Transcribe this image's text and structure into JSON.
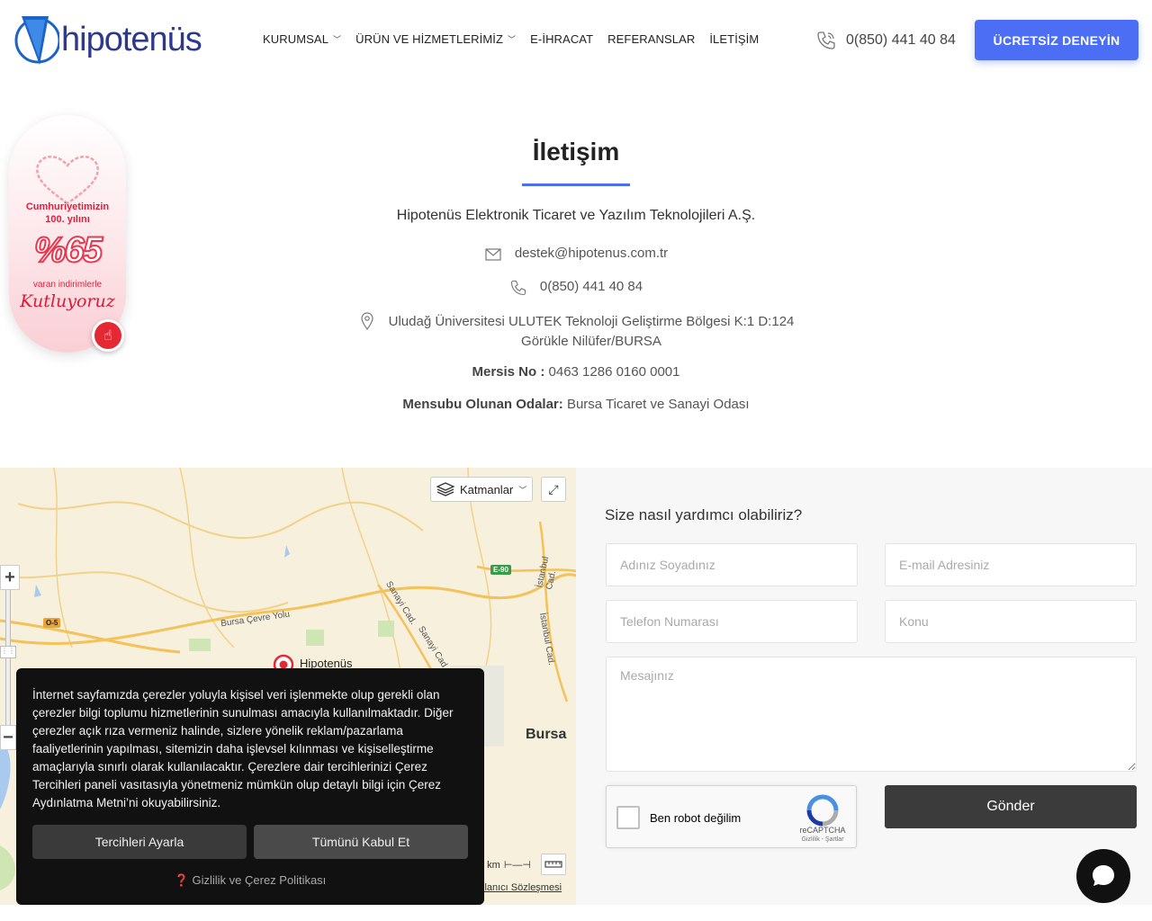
{
  "header": {
    "logo_text": "hipotenüs",
    "nav": [
      {
        "label": "KURUMSAL",
        "has_dropdown": true
      },
      {
        "label": "ÜRÜN VE HİZMETLERİMİZ",
        "has_dropdown": true
      },
      {
        "label": "E-İHRACAT",
        "has_dropdown": false
      },
      {
        "label": "REFERANSLAR",
        "has_dropdown": false
      },
      {
        "label": "İLETİŞİM",
        "has_dropdown": false
      }
    ],
    "phone": "0(850) 441 40 84",
    "cta_label": "ÜCRETSİZ DENEYİN",
    "accent_color": "#4c6ef5"
  },
  "promo": {
    "line1": "Cumhuriyetimizin",
    "line2": "100. yılını",
    "big": "%65",
    "line3": "varan indirimlerle",
    "line4": "Kutluyoruz",
    "button_icon": "hand-pointer-icon",
    "color": "#e01e3c"
  },
  "contact": {
    "title": "İletişim",
    "company": "Hipotenüs Elektronik Ticaret ve Yazılım Teknolojileri A.Ş.",
    "email": "destek@hipotenus.com.tr",
    "phone": "0(850) 441 40 84",
    "address_line1": "Uludağ Üniversitesi ULUTEK Teknoloji Geliştirme Bölgesi K:1 D:124",
    "address_line2": "Görükle Nilüfer/BURSA",
    "mersis_label": "Mersis No :",
    "mersis_value": "0463 1286 0160 0001",
    "oda_label": "Mensubu Olunan Odalar:",
    "oda_value": "Bursa Ticaret ve Sanayi Odası"
  },
  "map": {
    "layers_label": "Katmanlar",
    "place_label": "Hipotenüs",
    "city_label": "Bursa",
    "scale_label": "4 km",
    "terms_label": "llanıcı Sözleşmesi",
    "road_labels": [
      "Bursa Çevre Yolu",
      "Sanayi Cad.",
      "Sanayi Cad.",
      "İstanbul Cad.",
      "İstanbul Cad."
    ],
    "shields": [
      "O-5",
      "E-90"
    ]
  },
  "cookie": {
    "text": "İnternet sayfamızda çerezler yoluyla kişisel veri işlenmekte olup gerekli olan çerezler bilgi toplumu hizmetlerinin sunulması amacıyla kullanılmaktadır. Diğer çerezler açık rıza vermeniz halinde, sizlere yönelik reklam/pazarlama faaliyetlerinin yapılması, sitemizin daha işlevsel kılınması ve kişiselleştirme amaçlarıyla sınırlı olarak kullanılacaktır. Çerezlere dair tercihlerinizi Çerez Tercihleri paneli vasıtasıyla yönetmeniz mümkün olup detaylı bilgi için Çerez Aydınlatma Metni’ni okuyabilirsiniz.",
    "pref_label": "Tercihleri Ayarla",
    "accept_label": "Tümünü Kabul Et",
    "policy_label": "Gizlilik ve Çerez Politikası"
  },
  "form": {
    "title": "Size nasıl yardımcı olabiliriz?",
    "name_placeholder": "Adınız Soyadınız",
    "email_placeholder": "E-mail Adresiniz",
    "phone_placeholder": "Telefon Numarası",
    "subject_placeholder": "Konu",
    "message_placeholder": "Mesajınız",
    "recaptcha_label": "Ben robot değilim",
    "recaptcha_brand": "reCAPTCHA",
    "recaptcha_terms": "Gizlilik - Şartlar",
    "submit_label": "Gönder"
  }
}
